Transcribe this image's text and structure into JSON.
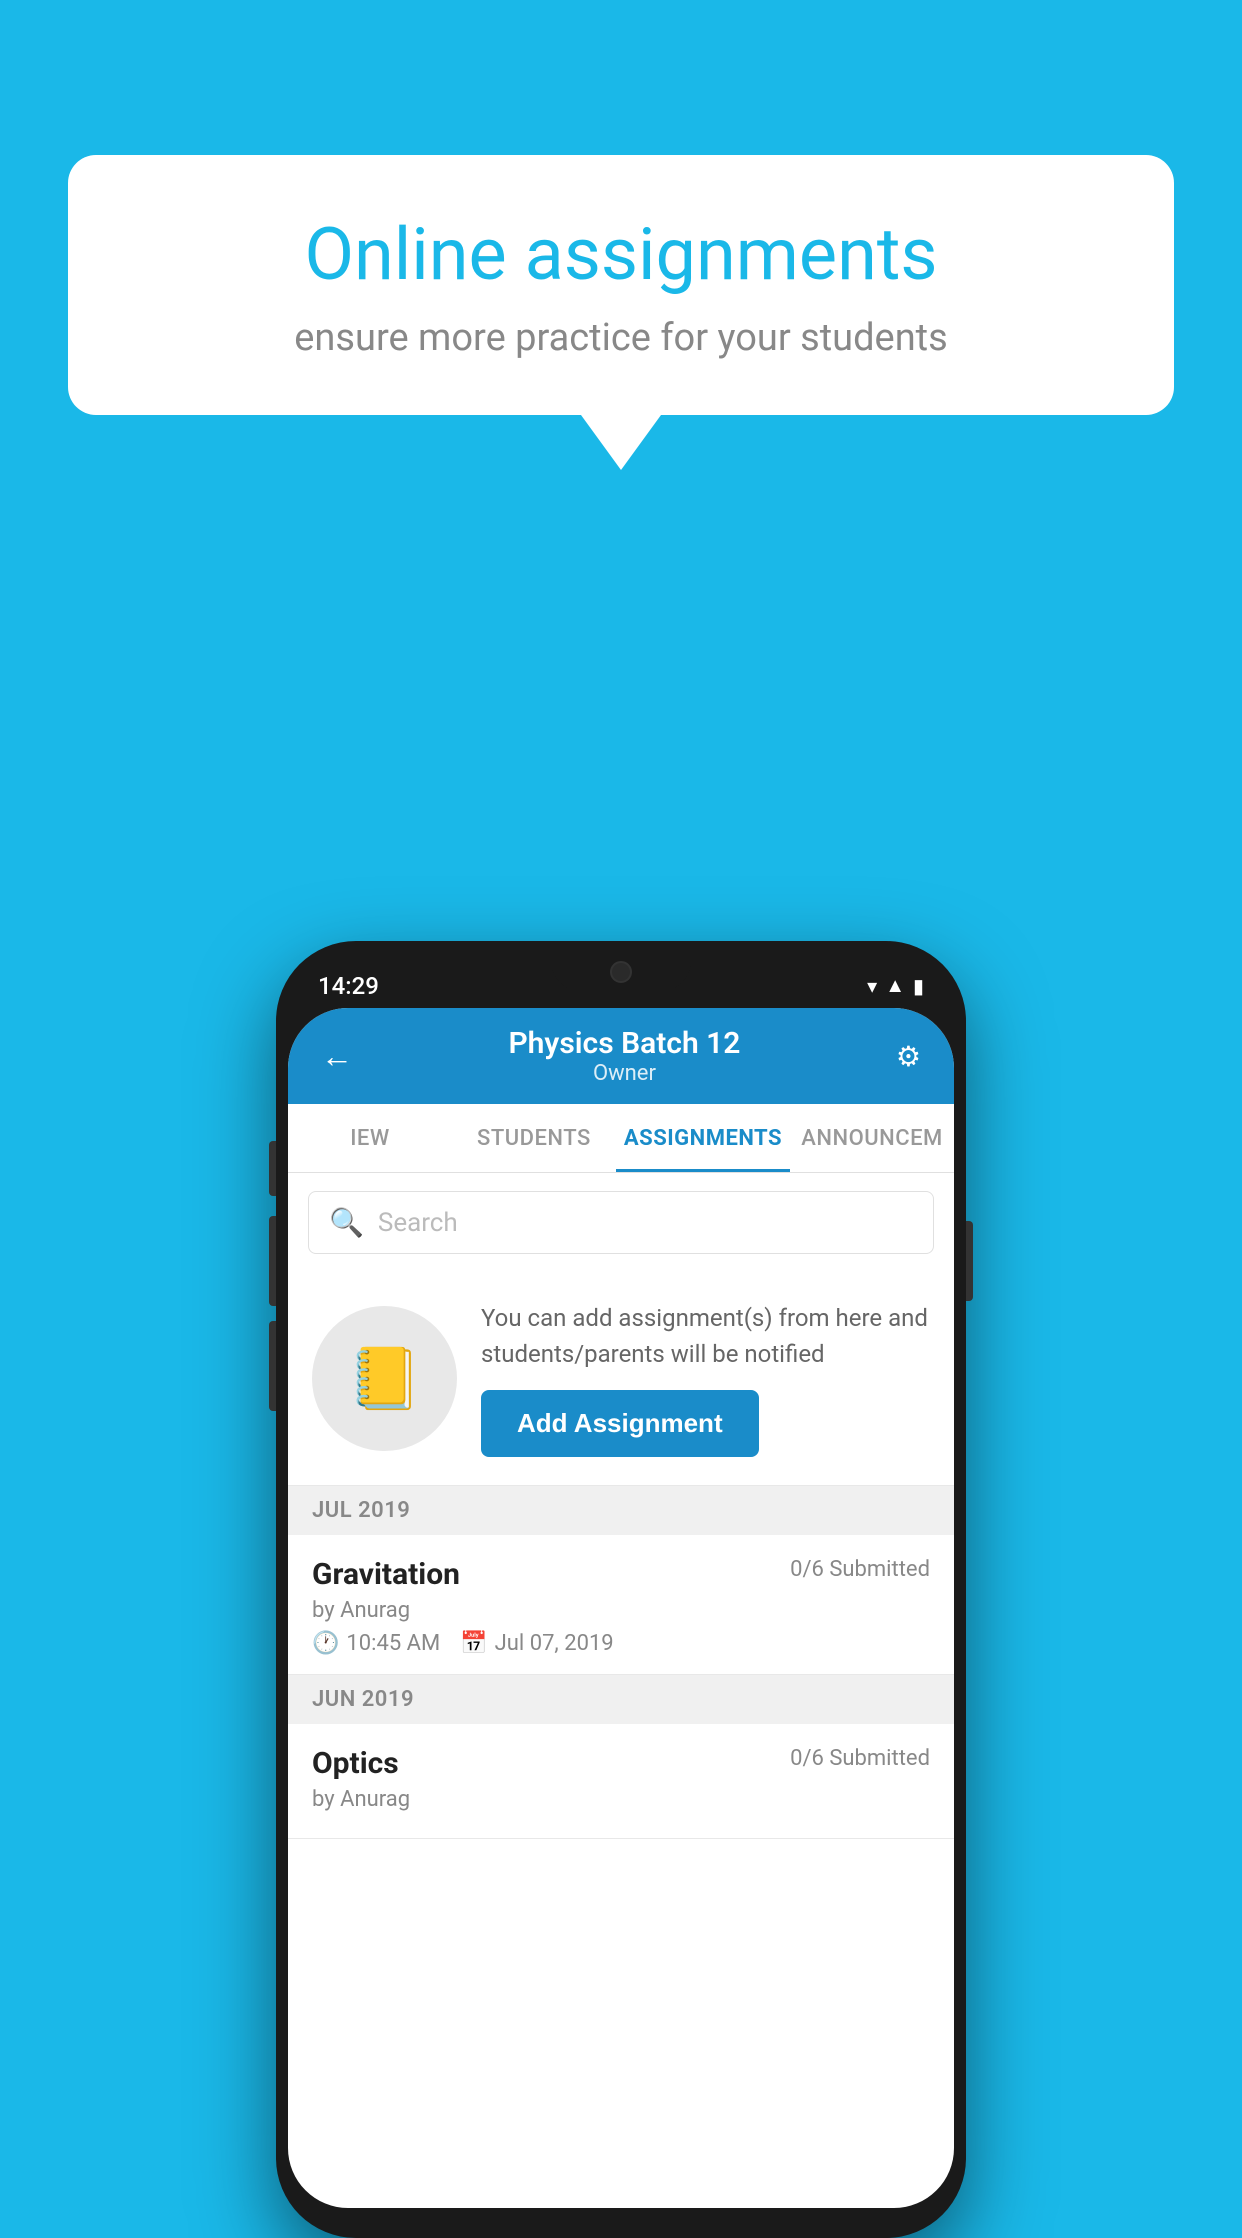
{
  "background_color": "#1ab8e8",
  "speech_bubble": {
    "title": "Online assignments",
    "subtitle": "ensure more practice for your students"
  },
  "phone": {
    "status_bar": {
      "time": "14:29",
      "icons": [
        "wifi",
        "signal",
        "battery"
      ]
    },
    "app_bar": {
      "title": "Physics Batch 12",
      "subtitle": "Owner",
      "back_label": "←",
      "settings_label": "⚙"
    },
    "tabs": [
      {
        "label": "IEW",
        "active": false
      },
      {
        "label": "STUDENTS",
        "active": false
      },
      {
        "label": "ASSIGNMENTS",
        "active": true
      },
      {
        "label": "ANNOUNCEM",
        "active": false
      }
    ],
    "search": {
      "placeholder": "Search"
    },
    "add_assignment_card": {
      "description": "You can add assignment(s) from here and students/parents will be notified",
      "button_label": "Add Assignment"
    },
    "sections": [
      {
        "header": "JUL 2019",
        "assignments": [
          {
            "name": "Gravitation",
            "submitted": "0/6 Submitted",
            "by": "by Anurag",
            "time": "10:45 AM",
            "date": "Jul 07, 2019"
          }
        ]
      },
      {
        "header": "JUN 2019",
        "assignments": [
          {
            "name": "Optics",
            "submitted": "0/6 Submitted",
            "by": "by Anurag",
            "time": "",
            "date": ""
          }
        ]
      }
    ]
  }
}
